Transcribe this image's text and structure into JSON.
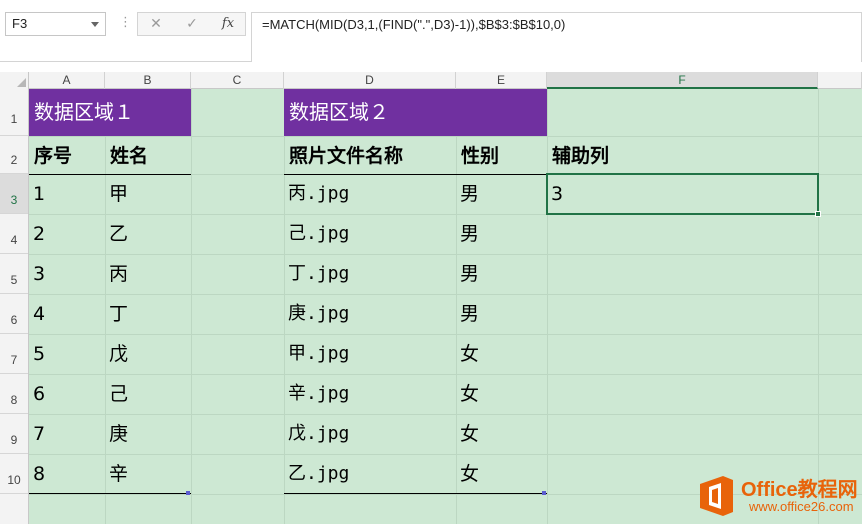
{
  "formula_bar": {
    "name_box": "F3",
    "cancel_symbol": "✕",
    "enter_symbol": "✓",
    "fx_symbol": "fx",
    "formula": "=MATCH(MID(D3,1,(FIND(\".\",D3)-1)),$B$3:$B$10,0)"
  },
  "columns": [
    "A",
    "B",
    "C",
    "D",
    "E",
    "F"
  ],
  "active_column": "F",
  "rows": [
    "1",
    "2",
    "3",
    "4",
    "5",
    "6",
    "7",
    "8",
    "9",
    "10"
  ],
  "active_row": "3",
  "sheet": {
    "header_color": "#7030a0",
    "grid_color": "#cde8d3",
    "region1_title": "数据区域１",
    "region2_title": "数据区域２",
    "col_a_header": "序号",
    "col_b_header": "姓名",
    "col_d_header": "照片文件名称",
    "col_e_header": "性别",
    "col_f_header": "辅助列",
    "data_rows": [
      {
        "no": "1",
        "name": "甲",
        "file": "丙.jpg",
        "gender": "男"
      },
      {
        "no": "2",
        "name": "乙",
        "file": "己.jpg",
        "gender": "男"
      },
      {
        "no": "3",
        "name": "丙",
        "file": "丁.jpg",
        "gender": "男"
      },
      {
        "no": "4",
        "name": "丁",
        "file": "庚.jpg",
        "gender": "男"
      },
      {
        "no": "5",
        "name": "戊",
        "file": "甲.jpg",
        "gender": "女"
      },
      {
        "no": "6",
        "name": "己",
        "file": "辛.jpg",
        "gender": "女"
      },
      {
        "no": "7",
        "name": "庚",
        "file": "戊.jpg",
        "gender": "女"
      },
      {
        "no": "8",
        "name": "辛",
        "file": "乙.jpg",
        "gender": "女"
      }
    ],
    "f3_value": "3"
  },
  "watermark": {
    "title": "Office教程网",
    "url": "www.office26.com",
    "accent": "#e8630a"
  }
}
